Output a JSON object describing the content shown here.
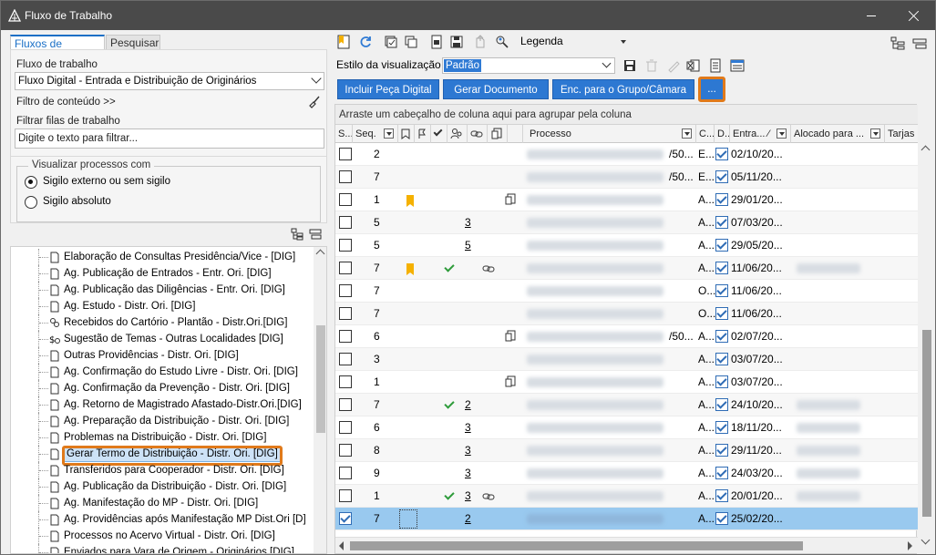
{
  "window": {
    "title": "Fluxo de Trabalho"
  },
  "left": {
    "tabs": [
      "Fluxos de trabalho",
      "Pesquisar"
    ],
    "fluxo_label": "Fluxo de trabalho",
    "fluxo_value": "Fluxo Digital - Entrada e Distribuição de Originários",
    "filtro_conteudo": "Filtro de conteúdo >>",
    "filtrar_filas_label": "Filtrar filas de trabalho",
    "filtrar_placeholder": "Digite o texto para filtrar...",
    "sigilo_group": "Visualizar processos com",
    "sigilo_options": [
      "Sigilo externo ou sem sigilo",
      "Sigilo absoluto"
    ],
    "tree_items": [
      "Elaboração de Consultas Presidência/Vice - [DIG]",
      "Ag. Publicação de Entrados - Entr. Ori. [DIG]",
      "Ag. Publicação das Diligências - Entr. Ori. [DIG]",
      "Ag. Estudo - Distr. Ori. [DIG]",
      "Recebidos do Cartório - Plantão - Distr.Ori.[DIG]",
      "Sugestão de Temas - Outras Localidades [DIG]",
      "Outras Providências - Distr. Ori. [DIG]",
      "Ag. Confirmação do Estudo Livre - Distr. Ori. [DIG]",
      "Ag. Confirmação da Prevenção - Distr. Ori. [DIG]",
      "Ag. Retorno de Magistrado Afastado-Distr.Ori.[DIG]",
      "Ag. Preparação da Distribuição - Distr. Ori. [DIG]",
      "Problemas na Distribuição - Distr. Ori. [DIG]",
      "Gerar Termo de Distribuição - Distr. Ori. [DIG]",
      "Transferidos para Cooperador - Distr. Ori. [DIG]",
      "Ag. Publicação da Distribuição - Distr. Ori. [DIG]",
      "Ag. Manifestação do MP - Distr. Ori. [DIG]",
      "Ag. Providências após Manifestação MP Dist.Ori [D]",
      "Processos no Acervo Virtual - Distr. Ori. [DIG]",
      "Enviados para Vara de Origem - Originários [DIG]"
    ]
  },
  "right": {
    "legenda": "Legenda",
    "estilo_label": "Estilo da visualização",
    "estilo_value": "Padrão",
    "buttons": [
      "Incluir Peça Digital",
      "Gerar Documento",
      "Enc. para o Grupo/Câmara",
      "..."
    ],
    "group_hint": "Arraste um cabeçalho de coluna aqui para agrupar pela coluna",
    "columns": [
      "S...",
      "Seq.",
      "Processo",
      "C...",
      "D...",
      "Entra... ⁄",
      "Alocado para ...",
      "Tarjas"
    ],
    "rows": [
      {
        "seq": "2",
        "flag": false,
        "tick": false,
        "num": "",
        "link": false,
        "doc": false,
        "mid": "/50...",
        "c": "E...",
        "date": "02/10/20...",
        "alloc": false,
        "sel": false
      },
      {
        "seq": "7",
        "flag": false,
        "tick": false,
        "num": "",
        "link": false,
        "doc": false,
        "mid": "/50...",
        "c": "E...",
        "date": "05/11/20...",
        "alloc": false,
        "sel": false
      },
      {
        "seq": "1",
        "flag": true,
        "tick": false,
        "num": "",
        "link": false,
        "doc": true,
        "mid": "",
        "c": "A...",
        "date": "29/01/20...",
        "alloc": false,
        "sel": false
      },
      {
        "seq": "5",
        "flag": false,
        "tick": false,
        "num": "3",
        "link": false,
        "doc": false,
        "mid": "",
        "c": "A...",
        "date": "07/03/20...",
        "alloc": false,
        "sel": false
      },
      {
        "seq": "5",
        "flag": false,
        "tick": false,
        "num": "5",
        "link": false,
        "doc": false,
        "mid": "",
        "c": "A...",
        "date": "29/05/20...",
        "alloc": false,
        "sel": false
      },
      {
        "seq": "7",
        "flag": true,
        "tick": true,
        "num": "",
        "link": true,
        "doc": false,
        "mid": "",
        "c": "A...",
        "date": "11/06/20...",
        "alloc": true,
        "sel": false
      },
      {
        "seq": "7",
        "flag": false,
        "tick": false,
        "num": "",
        "link": false,
        "doc": false,
        "mid": "",
        "c": "O...",
        "date": "11/06/20...",
        "alloc": false,
        "sel": false
      },
      {
        "seq": "7",
        "flag": false,
        "tick": false,
        "num": "",
        "link": false,
        "doc": false,
        "mid": "",
        "c": "O...",
        "date": "11/06/20...",
        "alloc": false,
        "sel": false
      },
      {
        "seq": "6",
        "flag": false,
        "tick": false,
        "num": "",
        "link": false,
        "doc": true,
        "mid": "/50...",
        "c": "A...",
        "date": "02/07/20...",
        "alloc": false,
        "sel": false
      },
      {
        "seq": "3",
        "flag": false,
        "tick": false,
        "num": "",
        "link": false,
        "doc": false,
        "mid": "",
        "c": "A...",
        "date": "03/07/20...",
        "alloc": false,
        "sel": false
      },
      {
        "seq": "1",
        "flag": false,
        "tick": false,
        "num": "",
        "link": false,
        "doc": true,
        "mid": "",
        "c": "A...",
        "date": "03/07/20...",
        "alloc": false,
        "sel": false
      },
      {
        "seq": "7",
        "flag": false,
        "tick": true,
        "num": "2",
        "link": false,
        "doc": false,
        "mid": "",
        "c": "A...",
        "date": "24/10/20...",
        "alloc": true,
        "sel": false
      },
      {
        "seq": "6",
        "flag": false,
        "tick": false,
        "num": "3",
        "link": false,
        "doc": false,
        "mid": "",
        "c": "A...",
        "date": "18/11/20...",
        "alloc": true,
        "sel": false
      },
      {
        "seq": "8",
        "flag": false,
        "tick": false,
        "num": "3",
        "link": false,
        "doc": false,
        "mid": "",
        "c": "A...",
        "date": "29/11/20...",
        "alloc": true,
        "sel": false
      },
      {
        "seq": "9",
        "flag": false,
        "tick": false,
        "num": "3",
        "link": false,
        "doc": false,
        "mid": "",
        "c": "A...",
        "date": "24/03/20...",
        "alloc": true,
        "sel": false
      },
      {
        "seq": "1",
        "flag": false,
        "tick": true,
        "num": "3",
        "link": true,
        "doc": false,
        "mid": "",
        "c": "A...",
        "date": "20/01/20...",
        "alloc": true,
        "sel": false
      },
      {
        "seq": "7",
        "flag": false,
        "tick": false,
        "num": "2",
        "link": false,
        "doc": false,
        "mid": "",
        "c": "A...",
        "date": "25/02/20...",
        "alloc": false,
        "sel": true
      }
    ]
  }
}
